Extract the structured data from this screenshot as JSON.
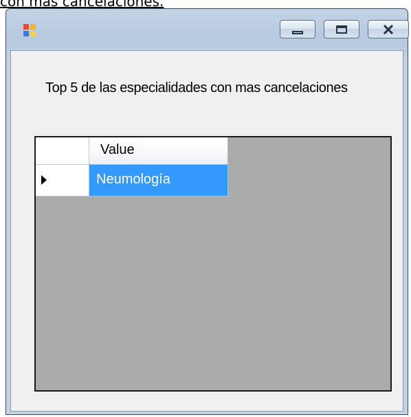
{
  "page_header": {
    "text": "con mas cancelaciones."
  },
  "window": {
    "controls": {
      "minimize_glyph": "▭",
      "maximize_glyph": "□",
      "close_glyph": "✕"
    }
  },
  "form": {
    "label": "Top 5 de las especialidades con mas cancelaciones"
  },
  "grid": {
    "columns": [
      "Value"
    ],
    "rows": [
      {
        "value": "Neumología",
        "selected": true
      }
    ]
  },
  "colors": {
    "selection": "#3399ff",
    "grid_background": "#ababab",
    "form_background": "#f0f0f0"
  }
}
